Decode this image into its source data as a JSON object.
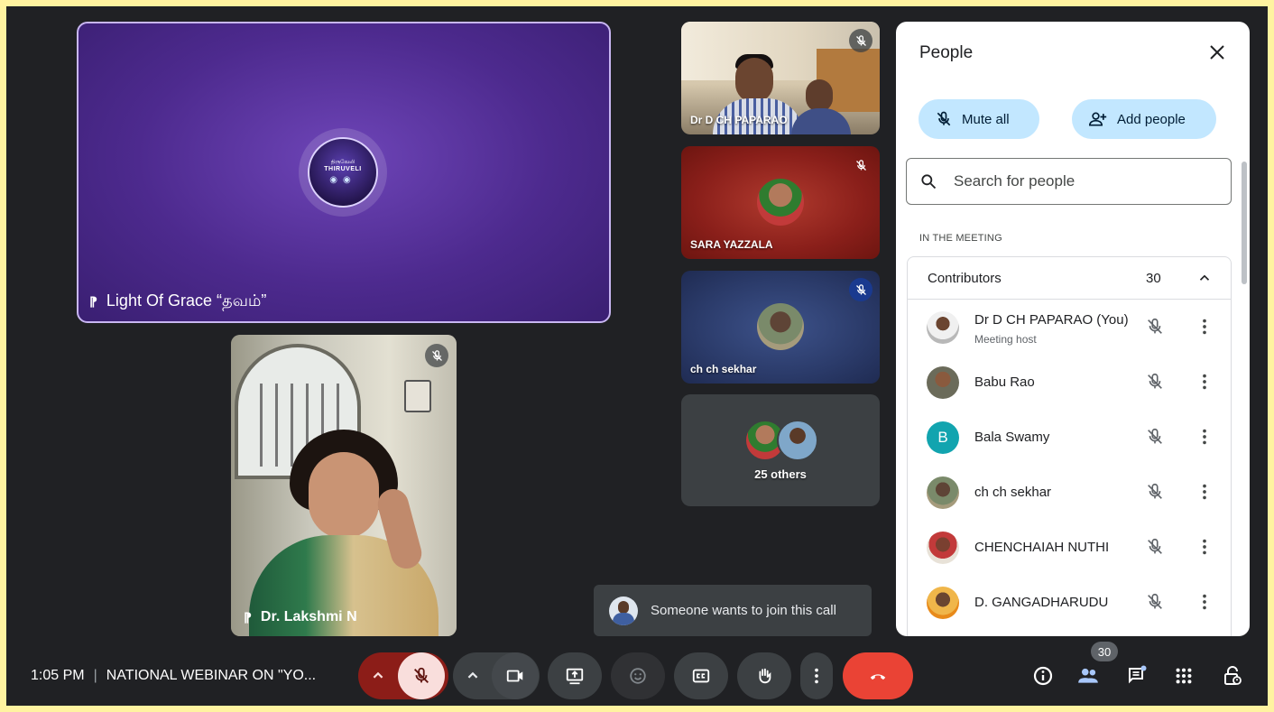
{
  "tiles": {
    "presenter": {
      "name": "Light Of Grace “தவம்”",
      "logo_line1": "திருவேலி",
      "logo_line2": "THIRUVELI"
    },
    "lakshmi": {
      "name": "Dr. Lakshmi N"
    },
    "paparao": {
      "name": "Dr D CH PAPARAO"
    },
    "sara": {
      "name": "SARA YAZZALA"
    },
    "sekhar": {
      "name": "ch ch sekhar"
    },
    "others": {
      "label": "25 others"
    }
  },
  "panel": {
    "title": "People",
    "mute_all": "Mute all",
    "add_people": "Add people",
    "search_placeholder": "Search for people",
    "section_label": "IN THE MEETING",
    "group_label": "Contributors",
    "group_count": "30",
    "people": [
      {
        "name": "Dr D CH PAPARAO (You)",
        "sub": "Meeting host",
        "avatar": "photo"
      },
      {
        "name": "Babu Rao",
        "sub": "",
        "avatar": "photo"
      },
      {
        "name": "Bala Swamy",
        "sub": "",
        "avatar": "B"
      },
      {
        "name": "ch ch sekhar",
        "sub": "",
        "avatar": "photo"
      },
      {
        "name": "CHENCHAIAH NUTHI",
        "sub": "",
        "avatar": "photo"
      },
      {
        "name": "D. GANGADHARUDU",
        "sub": "",
        "avatar": "photo"
      }
    ]
  },
  "toast": {
    "text": "Someone wants to join this call"
  },
  "bottombar": {
    "time": "1:05 PM",
    "separator": "|",
    "meeting_title": "NATIONAL WEBINAR ON \"YO...",
    "people_count": "30"
  },
  "colors": {
    "background": "#202124",
    "end_call": "#ea4335",
    "mic_muted_bg": "#f9dedc",
    "pill_blue": "#c2e7ff",
    "avatar_teal": "#12a4af"
  }
}
